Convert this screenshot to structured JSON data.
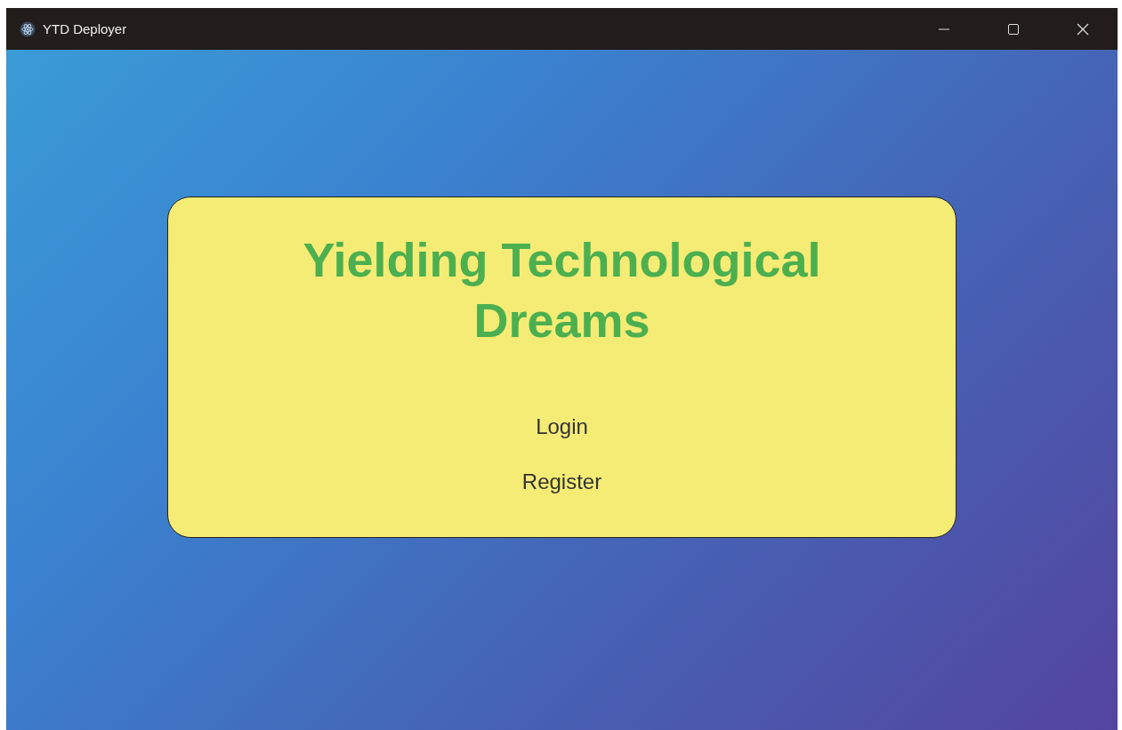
{
  "window": {
    "title": "YTD Deployer"
  },
  "card": {
    "heading": "Yielding Technological Dreams",
    "links": [
      {
        "label": "Login"
      },
      {
        "label": "Register"
      }
    ]
  }
}
